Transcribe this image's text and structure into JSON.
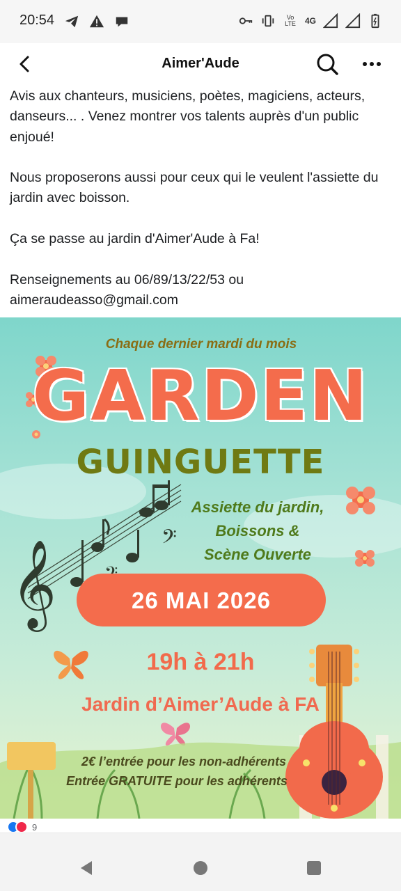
{
  "status_bar": {
    "time": "20:54",
    "left_icons": [
      "telegram-icon",
      "warning-icon",
      "chat-bubble-icon"
    ],
    "right_icons": [
      "key-icon",
      "vibrate-icon",
      "volte-icon",
      "signal-icon",
      "signal-icon",
      "battery-icon"
    ],
    "volte_top": "Vo",
    "volte_bottom": "LTE",
    "network": "4G"
  },
  "app_bar": {
    "title": "Aimer'Aude",
    "back_icon": "chevron-left-icon",
    "search_icon": "search-icon",
    "more_icon": "more-horizontal-icon"
  },
  "post": {
    "paragraphs": [
      "Avis aux chanteurs, musiciens, poètes, magiciens, acteurs, danseurs... . Venez montrer vos talents auprès d'un public enjoué!",
      "Nous proposerons aussi pour ceux qui le veulent l'assiette du jardin avec boisson.",
      "Ça se passe au jardin d'Aimer'Aude à Fa!",
      "Renseignements au 06/89/13/22/53 ou aimeraudeasso@gmail.com"
    ]
  },
  "poster": {
    "top_line": "Chaque dernier mardi du mois",
    "title": "GARDEN",
    "subtitle": "GUINGUETTE",
    "offer_lines": [
      "Assiette du jardin,",
      "Boissons &",
      "Scène Ouverte"
    ],
    "date": "26 MAI 2026",
    "time": "19h à 21h",
    "place": "Jardin d’Aimer’Aude à FA",
    "price_line_1": "2€ l’entrée pour les non-adhérents",
    "price_line_2": "Entrée GRATUITE pour les adhérents",
    "colors": {
      "coral": "#f46c4c",
      "olive": "#6f7a13",
      "sky": "#7fd6cb"
    }
  },
  "reactions": {
    "icons": [
      "like-reaction-icon",
      "love-reaction-icon"
    ],
    "count": "9"
  },
  "nav_bar": {
    "icons": [
      "nav-back-icon",
      "nav-home-icon",
      "nav-recents-icon"
    ]
  }
}
